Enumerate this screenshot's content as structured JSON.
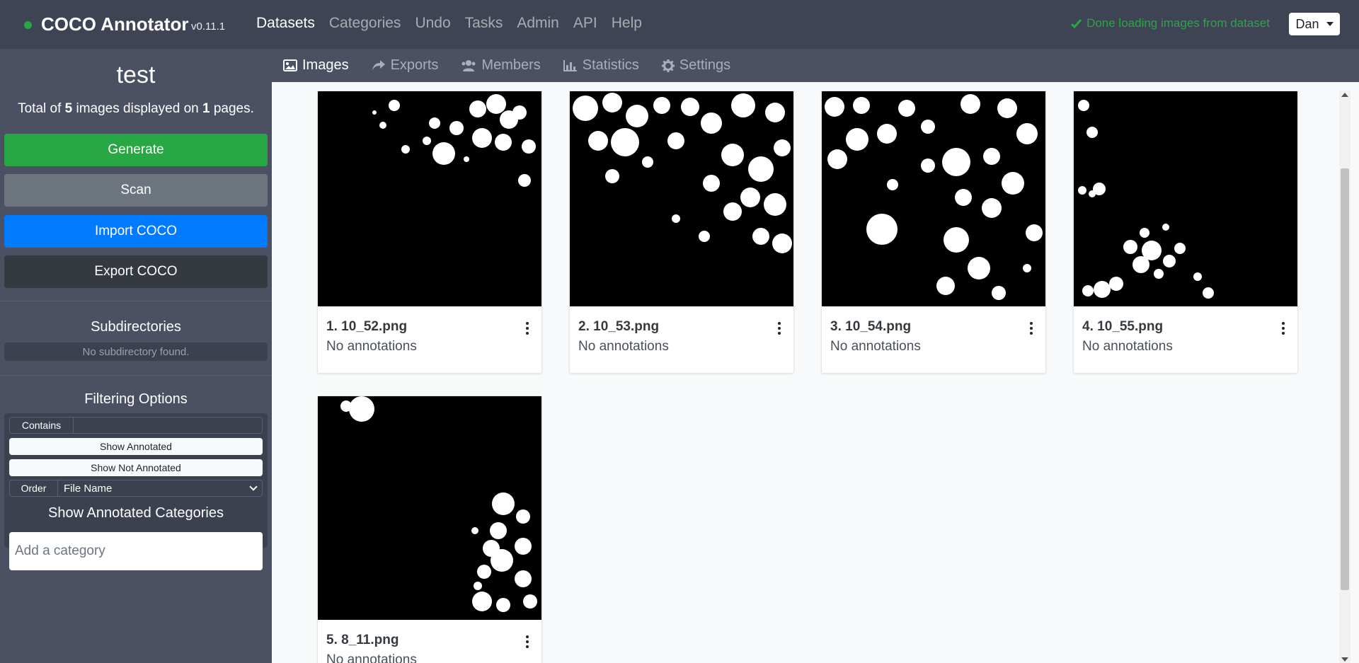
{
  "app": {
    "brand": "COCO Annotator",
    "version": "v0.11.1",
    "status_dot_color": "#28a745"
  },
  "nav": {
    "items": [
      "Datasets",
      "Categories",
      "Undo",
      "Tasks",
      "Admin",
      "API",
      "Help"
    ],
    "active": "Datasets",
    "status_message": "Done loading images from dataset",
    "user": "Dan"
  },
  "sidebar": {
    "dataset_name": "test",
    "summary": {
      "prefix": "Total of ",
      "images": "5",
      "middle": " images displayed on ",
      "pages": "1",
      "suffix": " pages."
    },
    "buttons": {
      "generate": "Generate",
      "scan": "Scan",
      "import": "Import COCO",
      "export": "Export COCO"
    },
    "subdirectories": {
      "title": "Subdirectories",
      "empty": "No subdirectory found."
    },
    "filtering": {
      "title": "Filtering Options",
      "contains_label": "Contains",
      "contains_value": "",
      "show_annotated": "Show Annotated",
      "show_not_annotated": "Show Not Annotated",
      "order_label": "Order",
      "order_value": "File Name"
    },
    "categories": {
      "title": "Show Annotated Categories",
      "placeholder": "Add a category"
    }
  },
  "tabs": [
    {
      "label": "Images",
      "icon": "image-icon",
      "active": true
    },
    {
      "label": "Exports",
      "icon": "share-icon",
      "active": false
    },
    {
      "label": "Members",
      "icon": "users-icon",
      "active": false
    },
    {
      "label": "Statistics",
      "icon": "bar-chart-icon",
      "active": false
    },
    {
      "label": "Settings",
      "icon": "gear-icon",
      "active": false
    }
  ],
  "images": [
    {
      "name": "1. 10_52.png",
      "status": "No annotations"
    },
    {
      "name": "2. 10_53.png",
      "status": "No annotations"
    },
    {
      "name": "3. 10_54.png",
      "status": "No annotations"
    },
    {
      "name": "4. 10_55.png",
      "status": "No annotations"
    },
    {
      "name": "5. 8_11.png",
      "status": "No annotations"
    }
  ],
  "colors": {
    "navbar": "#3f4454",
    "sidebar": "#4b5162",
    "success": "#28a745",
    "secondary": "#6c757d",
    "primary": "#007bff",
    "dark": "#343a40"
  }
}
